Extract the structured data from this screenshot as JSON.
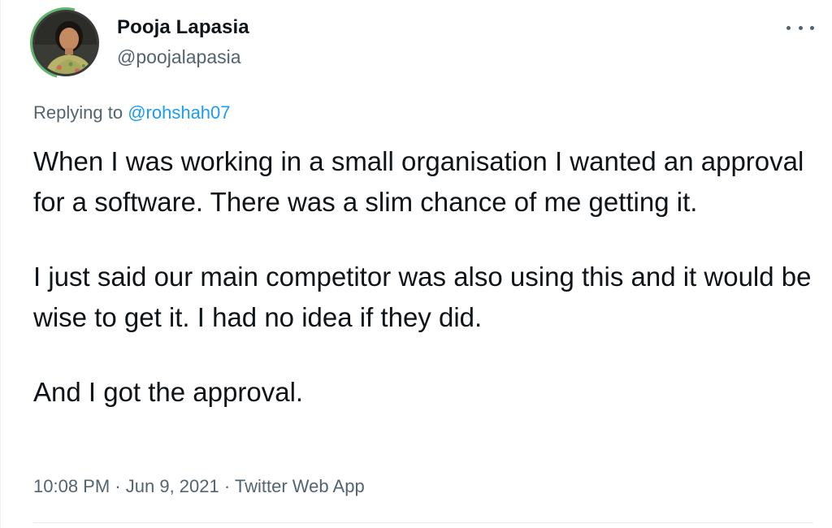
{
  "author": {
    "name": "Pooja Lapasia",
    "handle": "@poojalapasia",
    "avatar_icon": "profile-photo"
  },
  "more_icon": "more-horizontal-icon",
  "reply": {
    "prefix": "Replying to",
    "to": "@rohshah07"
  },
  "body": {
    "p1": "When I was working in a small organisation I wanted an approval for a software. There was a slim chance of me getting it.",
    "p2": "I just said our main competitor was also using this and it would be wise to get it. I had no idea if they did.",
    "p3": "And I got the approval."
  },
  "meta": {
    "time": "10:08 PM",
    "date": "Jun 9, 2021",
    "source": "Twitter Web App",
    "separator": "·"
  },
  "colors": {
    "text": "#0f1419",
    "secondary": "#536471",
    "link": "#1d9bf0"
  }
}
